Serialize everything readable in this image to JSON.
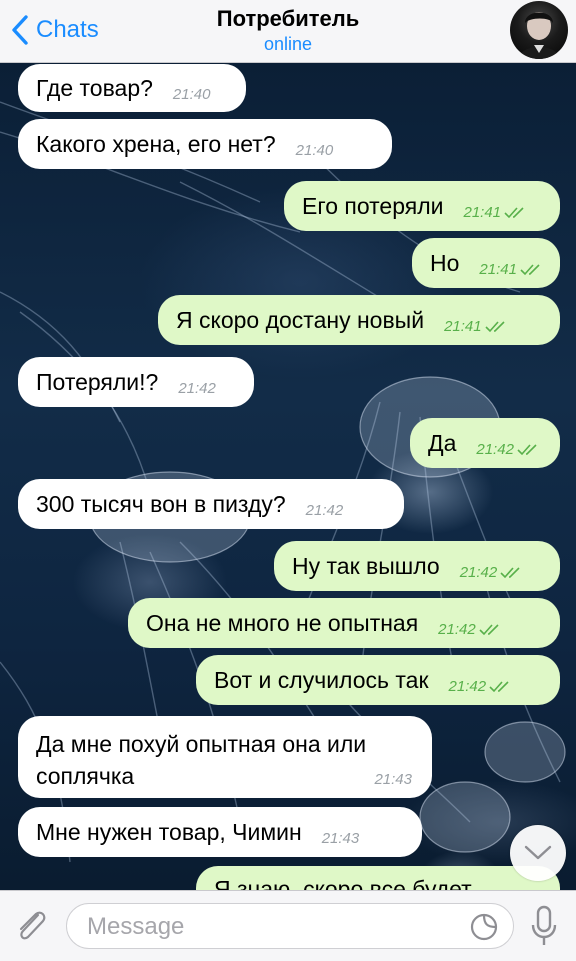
{
  "header": {
    "back_label": "Chats",
    "title": "Потребитель",
    "status": "online"
  },
  "messages": [
    {
      "dir": "in",
      "text": "Где товар?",
      "time": "21:40"
    },
    {
      "dir": "in",
      "text": "Какого хрена, его нет?",
      "time": "21:40"
    },
    {
      "dir": "out",
      "text": "Его потеряли",
      "time": "21:41",
      "read": true
    },
    {
      "dir": "out",
      "text": "Но",
      "time": "21:41",
      "read": true
    },
    {
      "dir": "out",
      "text": "Я скоро достану новый",
      "time": "21:41",
      "read": true
    },
    {
      "dir": "in",
      "text": "Потеряли!?",
      "time": "21:42"
    },
    {
      "dir": "out",
      "text": "Да",
      "time": "21:42",
      "read": true
    },
    {
      "dir": "in",
      "text": "300 тысяч вон в пизду?",
      "time": "21:42"
    },
    {
      "dir": "out",
      "text": "Ну так вышло",
      "time": "21:42",
      "read": true
    },
    {
      "dir": "out",
      "text": "Она не много не опытная",
      "time": "21:42",
      "read": true
    },
    {
      "dir": "out",
      "text": "Вот и случилось так",
      "time": "21:42",
      "read": true
    },
    {
      "dir": "in",
      "text": "Да мне похуй опытная она или соплячка",
      "time": "21:43"
    },
    {
      "dir": "in",
      "text": "Мне нужен товар, Чимин",
      "time": "21:43"
    },
    {
      "dir": "out",
      "text": "Я знаю, скоро все будет",
      "time": "",
      "read": true
    }
  ],
  "input": {
    "placeholder": "Message"
  },
  "colors": {
    "accent": "#1a8cff",
    "incoming_bubble": "#ffffff",
    "outgoing_bubble": "#dff8c7",
    "read_check": "#58b04a"
  },
  "icons": {
    "back": "chevron-left-icon",
    "attach": "paperclip-icon",
    "sticker": "sticker-icon",
    "mic": "microphone-icon",
    "scroll": "chevron-down-icon"
  }
}
